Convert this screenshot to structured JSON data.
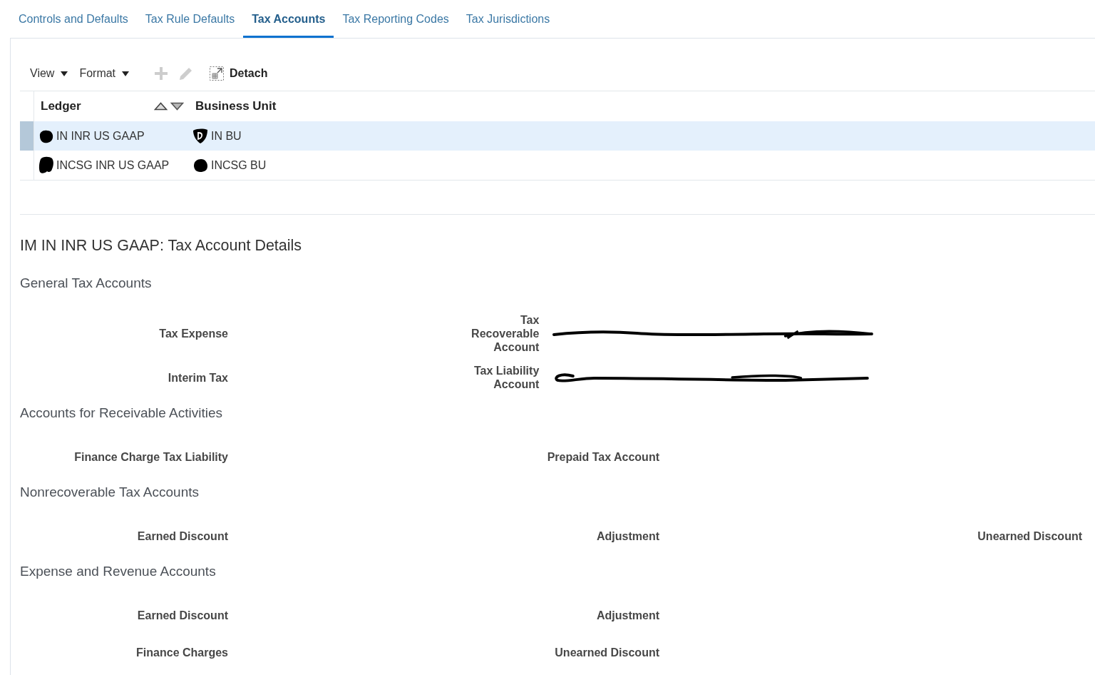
{
  "tabs": [
    {
      "label": "Controls and Defaults",
      "selected": false
    },
    {
      "label": "Tax Rule Defaults",
      "selected": false
    },
    {
      "label": "Tax Accounts",
      "selected": true
    },
    {
      "label": "Tax Reporting Codes",
      "selected": false
    },
    {
      "label": "Tax Jurisdictions",
      "selected": false
    }
  ],
  "toolbar": {
    "menus": [
      "View",
      "Format"
    ],
    "actions": [
      {
        "kind": "add",
        "disabled": true
      },
      {
        "kind": "edit",
        "disabled": true
      }
    ],
    "detach": {
      "label": "Detach"
    }
  },
  "table": {
    "columns": [
      {
        "label": "Ledger",
        "sortable": true
      },
      {
        "label": "Business Unit",
        "sortable": false
      }
    ],
    "rows": [
      {
        "selected": true,
        "cells": [
          "IN INR US GAAP",
          "IN BU"
        ]
      },
      {
        "selected": false,
        "cells": [
          "INCSG INR US GAAP",
          "INCSG BU"
        ]
      }
    ]
  },
  "details": {
    "title": "IM IN INR US GAAP: Tax Account Details",
    "sections": [
      {
        "title": "General Tax Accounts",
        "rows": [
          [
            {
              "label": "Tax Expense",
              "redacted": false
            },
            {
              "label": "Tax Recoverable Account",
              "redacted": true
            }
          ],
          [
            {
              "label": "Interim Tax",
              "redacted": false
            },
            {
              "label": "Tax Liability Account",
              "redacted": true
            }
          ]
        ]
      },
      {
        "title": "Accounts for Receivable Activities",
        "rows": [
          [
            {
              "label": "Finance Charge Tax Liability",
              "redacted": false
            },
            {
              "label": "Prepaid Tax Account",
              "redacted": false
            }
          ]
        ]
      },
      {
        "title": "Nonrecoverable Tax Accounts",
        "rows": [
          [
            {
              "label": "Earned Discount",
              "redacted": false
            },
            {
              "label": "Adjustment",
              "redacted": false
            },
            {
              "label": "Unearned Discount",
              "redacted": false
            }
          ]
        ]
      },
      {
        "title": "Expense and Revenue Accounts",
        "rows": [
          [
            {
              "label": "Earned Discount",
              "redacted": false
            },
            {
              "label": "Adjustment",
              "redacted": false
            }
          ],
          [
            {
              "label": "Finance Charges",
              "redacted": false
            },
            {
              "label": "Unearned Discount",
              "redacted": false
            }
          ]
        ]
      }
    ]
  }
}
